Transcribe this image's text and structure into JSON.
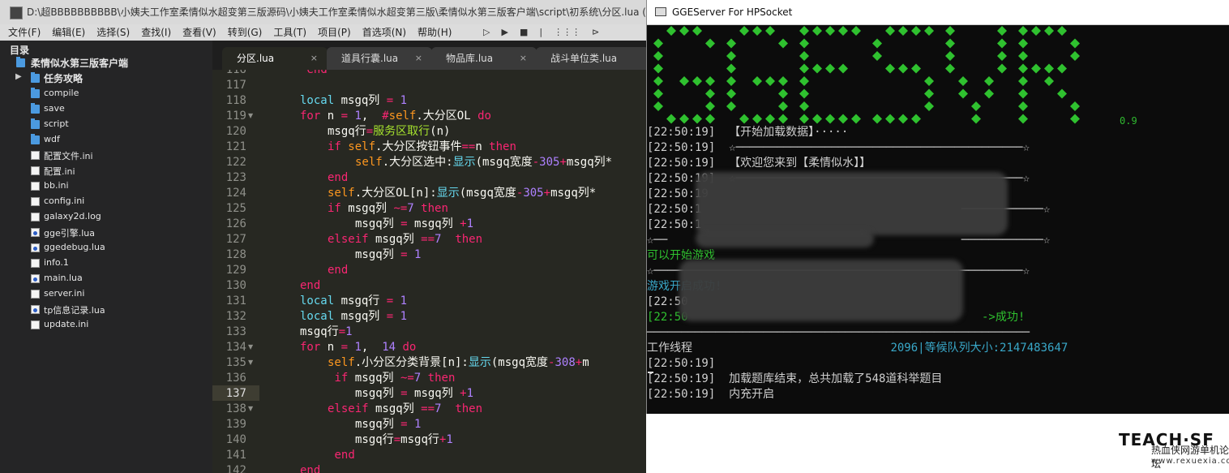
{
  "editor": {
    "title_path": "D:\\超BBBBBBBBBB\\小姨夫工作室柔情似水超变第三版源码\\小姨夫工作室柔情似水超变第三版\\柔情似水第三版客户端\\script\\初系统\\分区.lua (",
    "menu": [
      "文件(F)",
      "编辑(E)",
      "选择(S)",
      "查找(I)",
      "查看(V)",
      "转到(G)",
      "工具(T)",
      "项目(P)",
      "首选项(N)",
      "帮助(H)"
    ],
    "toolbar_glyphs": [
      "▷",
      "▶",
      "■",
      "|",
      "⋮⋮⋮",
      "⊳"
    ],
    "sidebar": {
      "heading": "目录",
      "root": "柔情似水第三版客户端",
      "items": [
        {
          "label": "任务攻略",
          "kind": "folder-collapsed"
        },
        {
          "label": "compile",
          "kind": "folder"
        },
        {
          "label": "save",
          "kind": "folder"
        },
        {
          "label": "script",
          "kind": "folder"
        },
        {
          "label": "wdf",
          "kind": "folder"
        },
        {
          "label": "配置文件.ini",
          "kind": "file"
        },
        {
          "label": "配置.ini",
          "kind": "file"
        },
        {
          "label": "bb.ini",
          "kind": "file"
        },
        {
          "label": "config.ini",
          "kind": "file"
        },
        {
          "label": "galaxy2d.log",
          "kind": "file"
        },
        {
          "label": "gge引擎.lua",
          "kind": "lua"
        },
        {
          "label": "ggedebug.lua",
          "kind": "lua"
        },
        {
          "label": "info.1",
          "kind": "file"
        },
        {
          "label": "main.lua",
          "kind": "lua"
        },
        {
          "label": "server.ini",
          "kind": "file"
        },
        {
          "label": "tp信息记录.lua",
          "kind": "lua"
        },
        {
          "label": "update.ini",
          "kind": "file"
        }
      ]
    },
    "tabs": [
      {
        "label": "分区.lua",
        "close": "×",
        "active": true
      },
      {
        "label": "道具行囊.lua",
        "close": "×",
        "active": false
      },
      {
        "label": "物品库.lua",
        "close": "×",
        "active": false
      },
      {
        "label": "战斗单位类.lua",
        "close": "",
        "active": false
      }
    ],
    "line_numbers": [
      "116",
      "117",
      "118",
      "119",
      "120",
      "121",
      "122",
      "123",
      "124",
      "125",
      "126",
      "127",
      "128",
      "129",
      "130",
      "131",
      "132",
      "133",
      "134",
      "135",
      "136",
      "137",
      "138",
      "139",
      "140",
      "141",
      "142"
    ],
    "fold_markers": [
      "119",
      "134",
      "135",
      "138"
    ],
    "current_line": "137",
    "code_lines": [
      {
        "indent": 5,
        "segs": [
          [
            "end",
            "#f92672"
          ]
        ]
      },
      {
        "indent": 0,
        "segs": []
      },
      {
        "indent": 4,
        "segs": [
          [
            "local",
            "#66d9ef"
          ],
          [
            " msgq列 ",
            "#f8f8f2"
          ],
          [
            "=",
            "#f92672"
          ],
          [
            " ",
            "#f8f8f2"
          ],
          [
            "1",
            "#ae81ff"
          ]
        ]
      },
      {
        "indent": 4,
        "segs": [
          [
            "for",
            "#f92672"
          ],
          [
            " n ",
            "#f8f8f2"
          ],
          [
            "=",
            "#f92672"
          ],
          [
            " ",
            "#f8f8f2"
          ],
          [
            "1",
            "#ae81ff"
          ],
          [
            ",  ",
            "#f8f8f2"
          ],
          [
            "#",
            "#f92672"
          ],
          [
            "self",
            "#fd971f"
          ],
          [
            ".大分区OL ",
            "#f8f8f2"
          ],
          [
            "do",
            "#f92672"
          ]
        ]
      },
      {
        "indent": 8,
        "segs": [
          [
            "msgq行",
            "#f8f8f2"
          ],
          [
            "=",
            "#f92672"
          ],
          [
            "服务区取行",
            "#a6e22e"
          ],
          [
            "(n)",
            "#f8f8f2"
          ]
        ]
      },
      {
        "indent": 8,
        "segs": [
          [
            "if",
            "#f92672"
          ],
          [
            " ",
            "#f8f8f2"
          ],
          [
            "self",
            "#fd971f"
          ],
          [
            ".大分区按钮事件",
            "#f8f8f2"
          ],
          [
            "==",
            "#f92672"
          ],
          [
            "n ",
            "#f8f8f2"
          ],
          [
            "then",
            "#f92672"
          ]
        ]
      },
      {
        "indent": 12,
        "segs": [
          [
            "self",
            "#fd971f"
          ],
          [
            ".大分区选中:",
            "#f8f8f2"
          ],
          [
            "显示",
            "#66d9ef"
          ],
          [
            "(msgq宽度",
            "#f8f8f2"
          ],
          [
            "-",
            "#f92672"
          ],
          [
            "305",
            "#ae81ff"
          ],
          [
            "+",
            "#f92672"
          ],
          [
            "msgq列*",
            "#f8f8f2"
          ]
        ]
      },
      {
        "indent": 8,
        "segs": [
          [
            "end",
            "#f92672"
          ]
        ]
      },
      {
        "indent": 8,
        "segs": [
          [
            "self",
            "#fd971f"
          ],
          [
            ".大分区OL[n]:",
            "#f8f8f2"
          ],
          [
            "显示",
            "#66d9ef"
          ],
          [
            "(msgq宽度",
            "#f8f8f2"
          ],
          [
            "-",
            "#f92672"
          ],
          [
            "305",
            "#ae81ff"
          ],
          [
            "+",
            "#f92672"
          ],
          [
            "msgq列*",
            "#f8f8f2"
          ]
        ]
      },
      {
        "indent": 8,
        "segs": [
          [
            "if",
            "#f92672"
          ],
          [
            " msgq列 ",
            "#f8f8f2"
          ],
          [
            "~=",
            "#f92672"
          ],
          [
            "7",
            "#ae81ff"
          ],
          [
            " ",
            "#f8f8f2"
          ],
          [
            "then",
            "#f92672"
          ]
        ]
      },
      {
        "indent": 12,
        "segs": [
          [
            "msgq列 ",
            "#f8f8f2"
          ],
          [
            "=",
            "#f92672"
          ],
          [
            " msgq列 ",
            "#f8f8f2"
          ],
          [
            "+",
            "#f92672"
          ],
          [
            "1",
            "#ae81ff"
          ]
        ]
      },
      {
        "indent": 8,
        "segs": [
          [
            "elseif",
            "#f92672"
          ],
          [
            " msgq列 ",
            "#f8f8f2"
          ],
          [
            "==",
            "#f92672"
          ],
          [
            "7",
            "#ae81ff"
          ],
          [
            "  ",
            "#f8f8f2"
          ],
          [
            "then",
            "#f92672"
          ]
        ]
      },
      {
        "indent": 12,
        "segs": [
          [
            "msgq列 ",
            "#f8f8f2"
          ],
          [
            "=",
            "#f92672"
          ],
          [
            " ",
            "#f8f8f2"
          ],
          [
            "1",
            "#ae81ff"
          ]
        ]
      },
      {
        "indent": 8,
        "segs": [
          [
            "end",
            "#f92672"
          ]
        ]
      },
      {
        "indent": 4,
        "segs": [
          [
            "end",
            "#f92672"
          ]
        ]
      },
      {
        "indent": 4,
        "segs": [
          [
            "local",
            "#66d9ef"
          ],
          [
            " msgq行 ",
            "#f8f8f2"
          ],
          [
            "=",
            "#f92672"
          ],
          [
            " ",
            "#f8f8f2"
          ],
          [
            "1",
            "#ae81ff"
          ]
        ]
      },
      {
        "indent": 4,
        "segs": [
          [
            "local",
            "#66d9ef"
          ],
          [
            " msgq列 ",
            "#f8f8f2"
          ],
          [
            "=",
            "#f92672"
          ],
          [
            " ",
            "#f8f8f2"
          ],
          [
            "1",
            "#ae81ff"
          ]
        ]
      },
      {
        "indent": 4,
        "segs": [
          [
            "msgq行",
            "#f8f8f2"
          ],
          [
            "=",
            "#f92672"
          ],
          [
            "1",
            "#ae81ff"
          ]
        ]
      },
      {
        "indent": 4,
        "segs": [
          [
            "for",
            "#f92672"
          ],
          [
            " n ",
            "#f8f8f2"
          ],
          [
            "=",
            "#f92672"
          ],
          [
            " ",
            "#f8f8f2"
          ],
          [
            "1",
            "#ae81ff"
          ],
          [
            ",  ",
            "#f8f8f2"
          ],
          [
            "14",
            "#ae81ff"
          ],
          [
            " ",
            "#f8f8f2"
          ],
          [
            "do",
            "#f92672"
          ]
        ]
      },
      {
        "indent": 8,
        "segs": [
          [
            "self",
            "#fd971f"
          ],
          [
            ".小分区分类背景[n]:",
            "#f8f8f2"
          ],
          [
            "显示",
            "#66d9ef"
          ],
          [
            "(msgq宽度",
            "#f8f8f2"
          ],
          [
            "-",
            "#f92672"
          ],
          [
            "308",
            "#ae81ff"
          ],
          [
            "+",
            "#f92672"
          ],
          [
            "m",
            "#f8f8f2"
          ]
        ]
      },
      {
        "indent": 9,
        "segs": [
          [
            "if",
            "#f92672"
          ],
          [
            " msgq列 ",
            "#f8f8f2"
          ],
          [
            "~=",
            "#f92672"
          ],
          [
            "7",
            "#ae81ff"
          ],
          [
            " ",
            "#f8f8f2"
          ],
          [
            "then",
            "#f92672"
          ]
        ]
      },
      {
        "indent": 12,
        "segs": [
          [
            "msgq列 ",
            "#f8f8f2"
          ],
          [
            "=",
            "#f92672"
          ],
          [
            " msgq列 ",
            "#f8f8f2"
          ],
          [
            "+",
            "#f92672"
          ],
          [
            "1",
            "#ae81ff"
          ]
        ]
      },
      {
        "indent": 8,
        "segs": [
          [
            "elseif",
            "#f92672"
          ],
          [
            " msgq列 ",
            "#f8f8f2"
          ],
          [
            "==",
            "#f92672"
          ],
          [
            "7",
            "#ae81ff"
          ],
          [
            "  ",
            "#f8f8f2"
          ],
          [
            "then",
            "#f92672"
          ]
        ]
      },
      {
        "indent": 12,
        "segs": [
          [
            "msgq列 ",
            "#f8f8f2"
          ],
          [
            "=",
            "#f92672"
          ],
          [
            " ",
            "#f8f8f2"
          ],
          [
            "1",
            "#ae81ff"
          ]
        ]
      },
      {
        "indent": 12,
        "segs": [
          [
            "msgq行",
            "#f8f8f2"
          ],
          [
            "=",
            "#f92672"
          ],
          [
            "msgq行",
            "#f8f8f2"
          ],
          [
            "+",
            "#f92672"
          ],
          [
            "1",
            "#ae81ff"
          ]
        ]
      },
      {
        "indent": 9,
        "segs": [
          [
            "end",
            "#f92672"
          ]
        ]
      },
      {
        "indent": 4,
        "segs": [
          [
            "end",
            "#f92672"
          ]
        ]
      }
    ]
  },
  "console": {
    "title": "GGEServer For HPSocket",
    "banner_text": "GGESVR",
    "banner_color": "#2fc12f",
    "version": "0.9",
    "lines": [
      {
        "text": "[22:50:19]  【开始加载数据】·····",
        "color": "default"
      },
      {
        "text": "[22:50:19]  ☆──────────────────────────────────────────☆",
        "color": "default"
      },
      {
        "text": "[22:50:19]  【欢迎您来到【柔情似水】】",
        "color": "default"
      },
      {
        "text": "[22:50:19]  ☆──────────────────────────────────────────☆",
        "color": "default"
      },
      {
        "text": "[22:50:19",
        "color": "default"
      },
      {
        "text": "[22:50:1                                      ────────────☆",
        "color": "default"
      },
      {
        "text": "[22:50:1",
        "color": "default"
      },
      {
        "text": "☆──                                           ────────────☆",
        "color": "default"
      },
      {
        "text": "可以开始游戏",
        "color": "green"
      },
      {
        "text": "☆──────────────────────────────────────────────────────☆",
        "color": "default"
      },
      {
        "text": "游戏开启成功!",
        "color": "cyan"
      },
      {
        "text": "[22:50",
        "color": "default"
      },
      {
        "text": "[22:50                                           ->成功!",
        "color": "green"
      },
      {
        "text": "────────────────────────────────────────────────────────",
        "color": "default"
      },
      {
        "text": "工作线程                             2096|等候队列大小:2147483647",
        "color": "mixed"
      },
      {
        "text": "[22:50:19]",
        "color": "default"
      },
      {
        "text": "[22:50:19]  加载题库结束，总共加载了548道科举题目",
        "color": "default"
      },
      {
        "text": "[22:50:19]  内充开启",
        "color": "default"
      }
    ]
  },
  "watermark": {
    "brand": "TEACH·SF",
    "site_cn": "热血侠网游单机论坛",
    "site_url": "www.rexuexia.com"
  }
}
